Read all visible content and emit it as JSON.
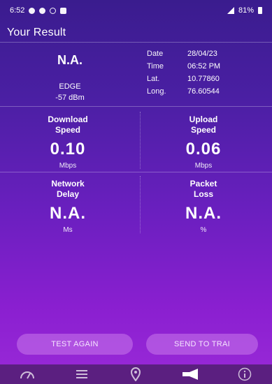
{
  "status_bar": {
    "time": "6:52",
    "battery": "81%"
  },
  "header": {
    "title": "Your Result"
  },
  "network": {
    "operator": "N.A.",
    "technology": "EDGE",
    "signal": "-57 dBm"
  },
  "details": [
    {
      "key": "Date",
      "value": "28/04/23"
    },
    {
      "key": "Time",
      "value": "06:52 PM"
    },
    {
      "key": "Lat.",
      "value": "10.77860"
    },
    {
      "key": "Long.",
      "value": "76.60544"
    }
  ],
  "download": {
    "label_line1": "Download",
    "label_line2": "Speed",
    "value": "0.10",
    "unit": "Mbps"
  },
  "upload": {
    "label_line1": "Upload",
    "label_line2": "Speed",
    "value": "0.06",
    "unit": "Mbps"
  },
  "delay": {
    "label_line1": "Network",
    "label_line2": "Delay",
    "value": "N.A.",
    "unit": "Ms"
  },
  "loss": {
    "label_line1": "Packet",
    "label_line2": "Loss",
    "value": "N.A.",
    "unit": "%"
  },
  "buttons": {
    "test_again": "TEST AGAIN",
    "send_to_trai": "SEND TO TRAI"
  },
  "nav_icons": [
    "speedometer-icon",
    "list-icon",
    "location-pin-icon",
    "megaphone-icon",
    "info-icon"
  ]
}
